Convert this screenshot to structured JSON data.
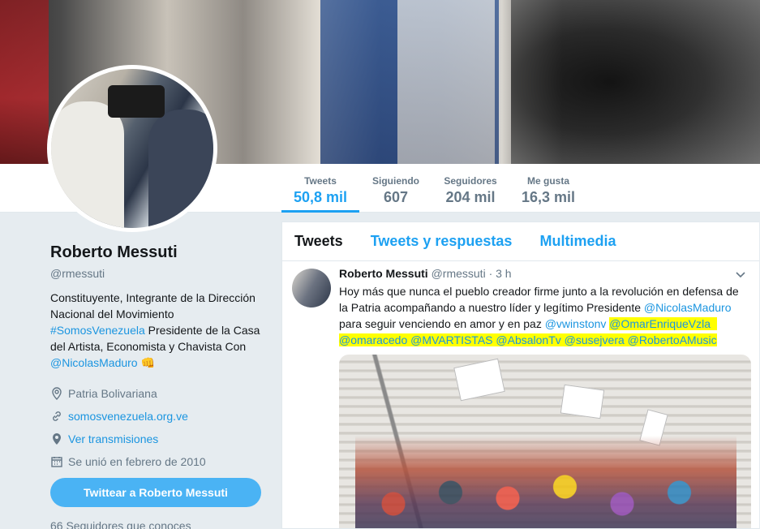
{
  "nav": {
    "items": [
      {
        "label": "Tweets",
        "value": "50,8 mil",
        "active": true
      },
      {
        "label": "Siguiendo",
        "value": "607",
        "active": false
      },
      {
        "label": "Seguidores",
        "value": "204 mil",
        "active": false
      },
      {
        "label": "Me gusta",
        "value": "16,3 mil",
        "active": false
      }
    ]
  },
  "profile": {
    "name": "Roberto Messuti",
    "handle": "@rmessuti",
    "bio_1": "Constituyente, Integrante de la Dirección Nacional del Movimiento ",
    "bio_link_1": "#SomosVenezuela",
    "bio_2": " Presidente de la Casa del Artista, Economista y Chavista Con ",
    "bio_link_2": "@NicolasMaduro",
    "bio_emoji": "👊",
    "location": "Patria Bolivariana",
    "website": "somosvenezuela.org.ve",
    "live": "Ver transmisiones",
    "joined": "Se unió en febrero de 2010",
    "tweet_to": "Twittear a Roberto Messuti",
    "followers_known": "66 Seguidores que conoces"
  },
  "timeline": {
    "tabs": [
      "Tweets",
      "Tweets y respuestas",
      "Multimedia"
    ],
    "tweet": {
      "name": "Roberto Messuti",
      "handle": "@rmessuti",
      "time": "· 3 h",
      "text_1": "Hoy más que nunca el pueblo creador firme junto a la revolución  en defensa de la Patria acompañando a nuestro líder y legítimo Presidente ",
      "mention_1": "@NicolasMaduro",
      "text_2": " para seguir venciendo en amor y en paz ",
      "mention_2": "@vwinstonv",
      "mention_3": "@OmarEnriqueVzla",
      "mention_4": "@omaracedo",
      "mention_5": "@MVARTISTAS",
      "mention_6": "@AbsalonTv",
      "mention_7": "@susejvera",
      "mention_8": "@RobertoAMusic"
    }
  },
  "colors": {
    "accent": "#1da1f2",
    "link": "#1b95e0",
    "highlight": "#ffff00"
  }
}
